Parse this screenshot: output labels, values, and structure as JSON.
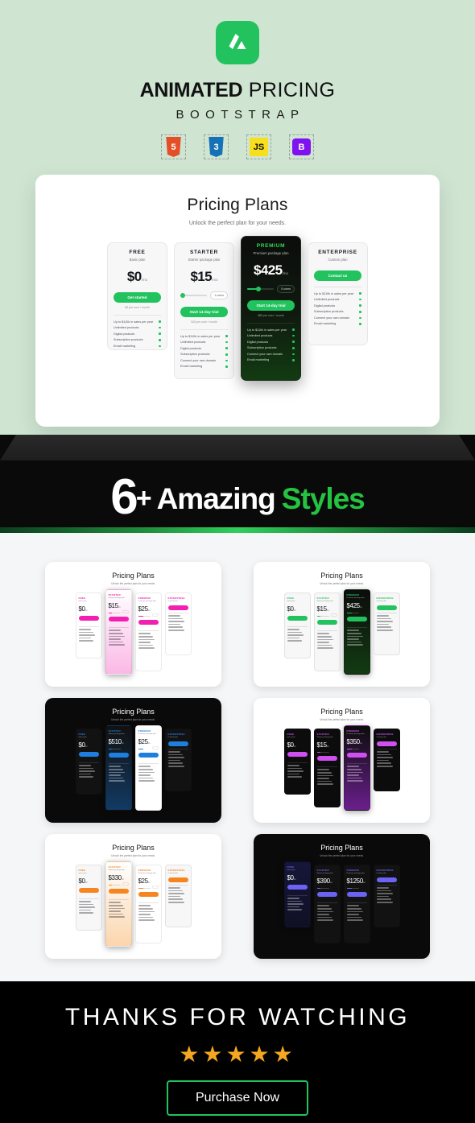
{
  "brand": {
    "logo_icon": "mountain-logo-icon",
    "logo_color": "#22c35e",
    "title_bold": "ANIMATED",
    "title_light": "PRICING",
    "subtitle": "BOOTSTRAP",
    "tech_badges": [
      {
        "name": "html5-icon",
        "label": "5"
      },
      {
        "name": "css3-icon",
        "label": "3"
      },
      {
        "name": "javascript-icon",
        "label": "JS"
      },
      {
        "name": "bootstrap-icon",
        "label": "B"
      }
    ]
  },
  "showcase": {
    "title": "Pricing Plans",
    "subtitle": "Unlock the perfect plan for your needs.",
    "plans": [
      {
        "name": "FREE",
        "desc": "Basic plan",
        "price": "$0",
        "period": "/mo",
        "has_slider": false,
        "cta": "Get started",
        "note": "$0 per user / month",
        "features": [
          "Up to $110k in sales per year",
          "Unlimited products",
          "Digital products",
          "Subscription products",
          "Email marketing"
        ]
      },
      {
        "name": "STARTER",
        "desc": "Starter package plan",
        "price": "$15",
        "period": "/mo",
        "has_slider": true,
        "slider_pct": 4,
        "users_pill": "1 users",
        "cta": "Start 14-day trial",
        "note": "$15 per user / month",
        "features": [
          "Up to $110k in sales per year",
          "Unlimited products",
          "Digital products",
          "Subscription products",
          "Connect your own domain",
          "Email marketing"
        ]
      },
      {
        "name": "PREMIUM",
        "desc": "Premium package plan",
        "price": "$425",
        "period": "/mo",
        "has_slider": true,
        "slider_pct": 38,
        "users_pill": "5 users",
        "cta": "Start 14-day trial",
        "note": "$85 per user / month",
        "features": [
          "Up to $110k in sales per year",
          "Unlimited products",
          "Digital products",
          "Subscription products",
          "Connect your own domain",
          "Email marketing"
        ]
      },
      {
        "name": "ENTERPRISE",
        "desc": "Custom plan",
        "price": "",
        "period": "",
        "has_slider": false,
        "cta": "Contact us",
        "note": "",
        "features": [
          "Up to $110k in sales per year",
          "Unlimited products",
          "Digital products",
          "Subscription products",
          "Connect your own domain",
          "Email marketing"
        ]
      }
    ]
  },
  "styles_banner": {
    "count": "6",
    "plus": "+",
    "word_white": "Amazing",
    "word_green": "Styles",
    "accent_color": "#25c342"
  },
  "variants": [
    {
      "theme": "light",
      "accent": "#f21fb0",
      "title": "Pricing Plans",
      "subtitle": "Unlock the perfect plan for your needs.",
      "cards": [
        {
          "name": "FREE",
          "desc": "Basic plan",
          "price": "$0",
          "period": "/mo",
          "bg": "#ffffff",
          "fg": "#16181d",
          "featured": false,
          "cta": "Get started"
        },
        {
          "name": "STARTER",
          "desc": "Starter package plan",
          "price": "$15",
          "period": "/mo",
          "bg": "linear-gradient(180deg,#ffffff,#fbb8e6)",
          "fg": "#16181d",
          "featured": true,
          "cta": "Start 14-day trial"
        },
        {
          "name": "PREMIUM",
          "desc": "Premium package plan",
          "price": "$25",
          "period": "/mo",
          "bg": "#ffffff",
          "fg": "#16181d",
          "featured": false,
          "cta": "Start 14-day trial"
        },
        {
          "name": "ENTERPRISE",
          "desc": "Custom plan",
          "price": "",
          "period": "",
          "bg": "#ffffff",
          "fg": "#16181d",
          "featured": false,
          "cta": "Contact us"
        }
      ]
    },
    {
      "theme": "light",
      "accent": "#22c35e",
      "title": "Pricing Plans",
      "subtitle": "Unlock the perfect plan for your needs.",
      "cards": [
        {
          "name": "FREE",
          "desc": "Basic plan",
          "price": "$0",
          "period": "/mo",
          "bg": "#f7f7f8",
          "fg": "#16181d",
          "featured": false,
          "cta": "Get started"
        },
        {
          "name": "STARTER",
          "desc": "Starter package plan",
          "price": "$15",
          "period": "/mo",
          "bg": "#f7f7f8",
          "fg": "#16181d",
          "featured": false,
          "cta": "Start 14-day trial"
        },
        {
          "name": "PREMIUM",
          "desc": "Premium package plan",
          "price": "$425",
          "period": "/mo",
          "bg": "linear-gradient(180deg,#0c0c0c,#123b12)",
          "fg": "#ffffff",
          "featured": true,
          "cta": "Start 14-day trial"
        },
        {
          "name": "ENTERPRISE",
          "desc": "Custom plan",
          "price": "",
          "period": "",
          "bg": "#f7f7f8",
          "fg": "#16181d",
          "featured": false,
          "cta": "Contact us"
        }
      ]
    },
    {
      "theme": "dark",
      "accent": "#1f7fe0",
      "title": "Pricing Plans",
      "subtitle": "Unlock the perfect plan for your needs.",
      "cards": [
        {
          "name": "FREE",
          "desc": "Basic plan",
          "price": "$0",
          "period": "/mo",
          "bg": "#121212",
          "fg": "#ffffff",
          "featured": false,
          "cta": "Get started"
        },
        {
          "name": "STARTER",
          "desc": "Starter package plan",
          "price": "$510",
          "period": "/mo",
          "bg": "linear-gradient(180deg,#111111,#123a63)",
          "fg": "#ffffff",
          "featured": true,
          "cta": "Start 14-day trial"
        },
        {
          "name": "PREMIUM",
          "desc": "Premium package plan",
          "price": "$25",
          "period": "/mo",
          "bg": "#ffffff",
          "fg": "#16181d",
          "featured": true,
          "cta": "Start 14-day trial"
        },
        {
          "name": "ENTERPRISE",
          "desc": "Custom plan",
          "price": "",
          "period": "",
          "bg": "#121212",
          "fg": "#ffffff",
          "featured": false,
          "cta": "Contact us"
        }
      ]
    },
    {
      "theme": "light",
      "accent": "#d04ff0",
      "title": "Pricing Plans",
      "subtitle": "Unlock the perfect plan for your needs.",
      "cards": [
        {
          "name": "FREE",
          "desc": "Basic plan",
          "price": "$0",
          "period": "/mo",
          "bg": "#0c0c0c",
          "fg": "#ffffff",
          "featured": false,
          "cta": "Get started"
        },
        {
          "name": "STARTER",
          "desc": "Starter package plan",
          "price": "$15",
          "period": "/mo",
          "bg": "#0c0c0c",
          "fg": "#ffffff",
          "featured": false,
          "cta": "Start 14-day trial"
        },
        {
          "name": "PREMIUM",
          "desc": "Premium package plan",
          "price": "$350",
          "period": "/mo",
          "bg": "linear-gradient(180deg,#0c0c0c,#6a1f8c)",
          "fg": "#ffffff",
          "featured": true,
          "cta": "Start 14-day trial"
        },
        {
          "name": "ENTERPRISE",
          "desc": "Custom plan",
          "price": "",
          "period": "",
          "bg": "#0c0c0c",
          "fg": "#ffffff",
          "featured": false,
          "cta": "Contact us"
        }
      ]
    },
    {
      "theme": "light",
      "accent": "#f7851f",
      "title": "Pricing Plans",
      "subtitle": "Unlock the perfect plan for your needs.",
      "cards": [
        {
          "name": "FREE",
          "desc": "Basic plan",
          "price": "$0",
          "period": "/mo",
          "bg": "#f7f7f8",
          "fg": "#16181d",
          "featured": false,
          "cta": "Get started"
        },
        {
          "name": "STARTER",
          "desc": "Starter package plan",
          "price": "$330",
          "period": "/mo",
          "bg": "linear-gradient(180deg,#ffffff,#fbd5ad)",
          "fg": "#16181d",
          "featured": true,
          "cta": "Start 14-day trial"
        },
        {
          "name": "PREMIUM",
          "desc": "Premium package plan",
          "price": "$25",
          "period": "/mo",
          "bg": "#ffffff",
          "fg": "#16181d",
          "featured": false,
          "cta": "Start 14-day trial"
        },
        {
          "name": "ENTERPRISE",
          "desc": "Custom plan",
          "price": "",
          "period": "",
          "bg": "#f7f7f8",
          "fg": "#16181d",
          "featured": false,
          "cta": "Contact us"
        }
      ]
    },
    {
      "theme": "dark",
      "accent": "#6c63f5",
      "title": "Pricing Plans",
      "subtitle": "Unlock the perfect plan for your needs.",
      "cards": [
        {
          "name": "FREE",
          "desc": "Basic plan",
          "price": "$0",
          "period": "/mo",
          "bg": "linear-gradient(180deg,#16163a,#101024)",
          "fg": "#ffffff",
          "featured": true,
          "cta": "Get started"
        },
        {
          "name": "STARTER",
          "desc": "Starter package plan",
          "price": "$390",
          "period": "/mo",
          "bg": "#121212",
          "fg": "#ffffff",
          "featured": false,
          "cta": "Start 14-day trial"
        },
        {
          "name": "PREMIUM",
          "desc": "Premium package plan",
          "price": "$1250",
          "period": "/mo",
          "bg": "#121212",
          "fg": "#ffffff",
          "featured": false,
          "cta": "Start 14-day trial"
        },
        {
          "name": "ENTERPRISE",
          "desc": "Custom plan",
          "price": "",
          "period": "",
          "bg": "#121212",
          "fg": "#ffffff",
          "featured": false,
          "cta": "Contact us"
        }
      ]
    }
  ],
  "footer": {
    "thanks": "THANKS FOR WATCHING",
    "stars": "★★★★★",
    "star_count": 5,
    "star_color": "#f5a623",
    "cta": "Purchase Now",
    "cta_border": "#22c35e"
  }
}
